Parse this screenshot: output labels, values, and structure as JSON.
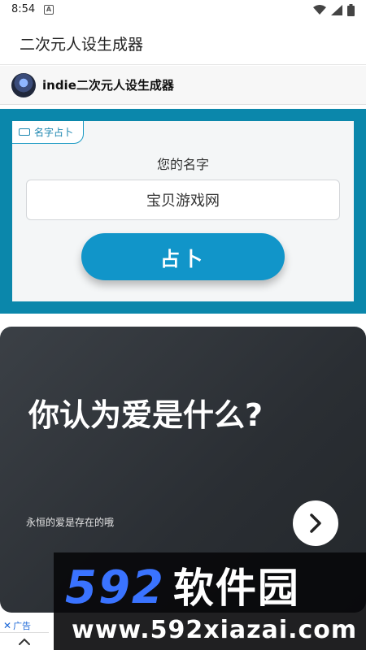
{
  "status_bar": {
    "time": "8:54",
    "notification_icon": "a-icon",
    "icons": [
      "wifi-icon",
      "signal-icon",
      "battery-icon"
    ]
  },
  "app_bar": {
    "title": "二次元人设生成器"
  },
  "site_header": {
    "avatar_icon": "avatar",
    "title": "indie二次元人设生成器"
  },
  "tool": {
    "tab_label": "名字占卜",
    "name_label": "您的名字",
    "name_value": "宝贝游戏网",
    "button_label": "占卜",
    "accent_color": "#0b87ab",
    "button_color": "#1195c9"
  },
  "ad": {
    "headline": "你认为爱是什么?",
    "subtitle": "永恒的爱是存在的哦",
    "next_icon": "chevron-right-icon",
    "badge_close": "✕",
    "badge_label": "广告"
  },
  "watermark": {
    "number": "592",
    "name": "软件园",
    "url": "www.592xiazai.com",
    "number_color": "#3a73ff"
  },
  "footer": {
    "collapse_icon": "chevron-up-icon"
  }
}
